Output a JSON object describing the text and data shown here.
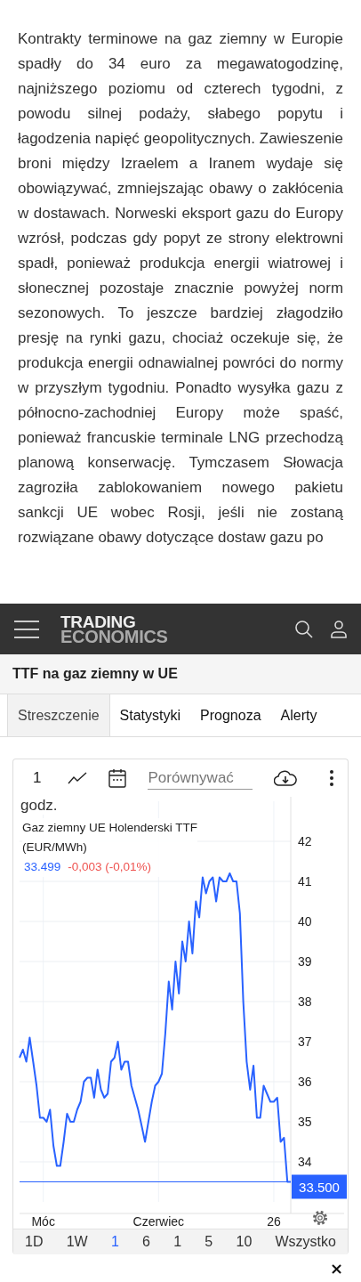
{
  "article": {
    "text": "Kontrakty terminowe na gaz ziemny w Europie spadły do 34 euro za megawatogodzinę, najniższego poziomu od czterech tygodni, z powodu silnej podaży, słabego popytu i łagodzenia napięć geopolitycznych. Zawieszenie broni między Izraelem a Iranem wydaje się obowiązywać, zmniejszając obawy o zakłócenia w dostawach. Norweski eksport gazu do Europy wzrósł, podczas gdy popyt ze strony elektrowni spadł, ponieważ produkcja energii wiatrowej i słonecznej pozostaje znacznie powyżej norm sezonowych. To jeszcze bardziej złagodziło presję na rynki gazu, chociaż oczekuje się, że produkcja energii odnawialnej powróci do normy w przyszłym tygodniu. Ponadto wysyłka gazu z północno-zachodniej Europy może spaść, ponieważ francuskie terminale LNG przechodzą planową konserwację. Tymczasem Słowacja zagroziła zablokowaniem nowego pakietu sankcji UE wobec Rosji, jeśli nie zostaną rozwiązane obawy dotyczące dostaw gazu po"
  },
  "header": {
    "logo_top": "TRADING",
    "logo_bottom": "ECONOMICS"
  },
  "page_title": "TTF na gaz ziemny w UE",
  "tabs": [
    {
      "label": "Streszczenie",
      "selected": true
    },
    {
      "label": "Statystyki",
      "selected": false
    },
    {
      "label": "Prognoza",
      "selected": false
    },
    {
      "label": "Alerty",
      "selected": false
    }
  ],
  "chart_widget": {
    "frequency": "1",
    "frequency_unit": "godz.",
    "compare_placeholder": "Porównywać",
    "legend": {
      "unit": "(EUR/MWh)",
      "price": "33.499",
      "change": "-0,003 (-0,01%)"
    },
    "chart_data": {
      "type": "line",
      "grid": true,
      "ylim": [
        33,
        43
      ],
      "ref_lines": [
        {
          "axis": "y",
          "value": 33.5,
          "label": "33.500",
          "color": "#2962ff"
        }
      ],
      "categories": [
        null,
        null,
        null,
        null,
        null,
        null,
        null,
        "Móc",
        null,
        null,
        null,
        null,
        null,
        null,
        null,
        null,
        null,
        null,
        null,
        null,
        null,
        null,
        null,
        null,
        null,
        null,
        null,
        null,
        null,
        null,
        null,
        null,
        null,
        null,
        null,
        null,
        null,
        null,
        null,
        null,
        null,
        "Czerwiec",
        null,
        null,
        null,
        null,
        null,
        null,
        null,
        null,
        null,
        null,
        null,
        null,
        null,
        null,
        null,
        null,
        null,
        null,
        null,
        null,
        null,
        null,
        null,
        null,
        null,
        null,
        null,
        null,
        null,
        null,
        null,
        null,
        null,
        "26",
        null,
        null,
        null,
        null,
        null
      ],
      "yticks": [
        34,
        35,
        36,
        37,
        38,
        39,
        40,
        41,
        42
      ],
      "series": [
        {
          "name": "Gaz ziemny UE Holenderski TTF",
          "color": "#2962ff",
          "values": [
            36.6,
            36.8,
            36.5,
            37.1,
            36.5,
            35.9,
            35.1,
            35.1,
            35.0,
            35.3,
            34.4,
            33.9,
            33.9,
            34.5,
            35.2,
            35.0,
            35.0,
            35.3,
            35.5,
            36.0,
            36.1,
            36.1,
            35.6,
            36.3,
            35.8,
            35.6,
            35.7,
            36.5,
            36.6,
            37.0,
            36.3,
            36.5,
            36.5,
            35.9,
            35.6,
            35.3,
            34.9,
            34.5,
            35.0,
            35.5,
            35.9,
            36.0,
            36.2,
            37.2,
            38.5,
            37.8,
            39.0,
            38.2,
            39.5,
            39.0,
            40.0,
            39.2,
            40.5,
            40.1,
            41.1,
            40.7,
            41.0,
            41.1,
            40.5,
            41.1,
            41.0,
            41.0,
            41.2,
            41.0,
            41.0,
            40.2,
            38.0,
            36.5,
            35.8,
            36.4,
            35.1,
            35.1,
            35.9,
            35.7,
            35.5,
            35.5,
            35.6,
            34.5,
            34.6,
            33.5,
            33.5
          ]
        }
      ]
    },
    "ranges": [
      {
        "label": "1D",
        "selected": false
      },
      {
        "label": "1W",
        "selected": false
      },
      {
        "label": "1",
        "selected": true
      },
      {
        "label": "6",
        "selected": false
      },
      {
        "label": "1",
        "selected": false
      },
      {
        "label": "5",
        "selected": false
      },
      {
        "label": "10",
        "selected": false
      },
      {
        "label": "Wszystko",
        "selected": false
      }
    ]
  },
  "close_button": "×"
}
